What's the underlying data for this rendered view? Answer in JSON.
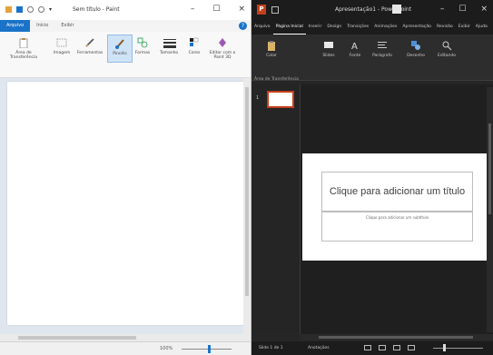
{
  "paint": {
    "title": "Sem título - Paint",
    "window_controls": [
      "–",
      "☐",
      "×"
    ],
    "tabs": [
      "Arquivo",
      "Início",
      "Exibir"
    ],
    "ribbon": [
      {
        "label": "Área de Transferência",
        "icon": "clipboard-icon"
      },
      {
        "label": "Imagem",
        "icon": "image-icon"
      },
      {
        "label": "Ferramentas",
        "icon": "pencil-icon"
      },
      {
        "label": "Pincéis",
        "icon": "brush-icon"
      },
      {
        "label": "Formas",
        "icon": "shapes-icon"
      },
      {
        "label": "Tamanho",
        "icon": "size-icon"
      },
      {
        "label": "Cores",
        "icon": "palette-icon"
      },
      {
        "label": "Editar com o Paint 3D",
        "icon": "paint3d-icon"
      }
    ],
    "status": {
      "zoom": "100%"
    }
  },
  "powerpoint": {
    "app_title": "Apresentação1 - PowerPoint",
    "window_controls": [
      "–",
      "☐",
      "×"
    ],
    "tabs": [
      "Arquivo",
      "Página Inicial",
      "Inserir",
      "Design",
      "Transições",
      "Animações",
      "Apresentação",
      "Revisão",
      "Exibir",
      "Ajuda"
    ],
    "active_tab_index": 1,
    "ribbon": [
      {
        "label": "Colar",
        "icon": "paste-icon"
      },
      {
        "label": "Slides",
        "icon": "slides-icon"
      },
      {
        "label": "Fonte",
        "icon": "font-icon"
      },
      {
        "label": "Parágrafo",
        "icon": "paragraph-icon"
      },
      {
        "label": "Desenho",
        "icon": "drawing-icon"
      },
      {
        "label": "Editando",
        "icon": "editing-icon"
      }
    ],
    "group_label": "Área de Transferência",
    "slide_number": "1",
    "slide": {
      "title_placeholder": "Clique para adicionar um título",
      "subtitle_placeholder": "Clique para adicionar um subtítulo"
    },
    "status": {
      "slide_info": "Slide 1 de 1",
      "notes": "Anotações"
    }
  }
}
